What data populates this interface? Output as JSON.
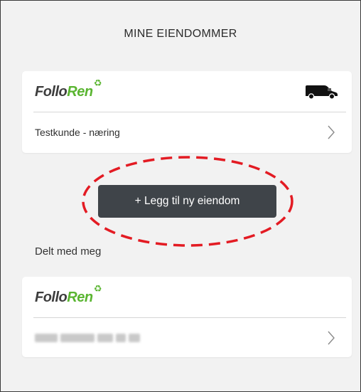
{
  "page": {
    "title": "MINE EIENDOMMER"
  },
  "properties": [
    {
      "logo": {
        "part1": "Follo",
        "part2": "Ren",
        "recycle_icon": "recycle-icon"
      },
      "service_icon": "truck-icon",
      "label": "Testkunde - næring",
      "action_icon": "chevron-right-icon"
    }
  ],
  "add_button": {
    "label": "+ Legg til ny eiendom"
  },
  "shared_section": {
    "title": "Delt med meg",
    "items": [
      {
        "logo": {
          "part1": "Follo",
          "part2": "Ren",
          "recycle_icon": "recycle-icon"
        },
        "label": "",
        "label_redacted": true,
        "action_icon": "chevron-right-icon"
      }
    ]
  },
  "annotation": {
    "type": "dashed-ellipse",
    "color": "#e31b23"
  },
  "colors": {
    "background": "#f2f2f2",
    "card": "#ffffff",
    "button": "#3f4449",
    "brand_green": "#5ab531",
    "brand_dark": "#3d3d3d",
    "annotation_red": "#e31b23"
  }
}
